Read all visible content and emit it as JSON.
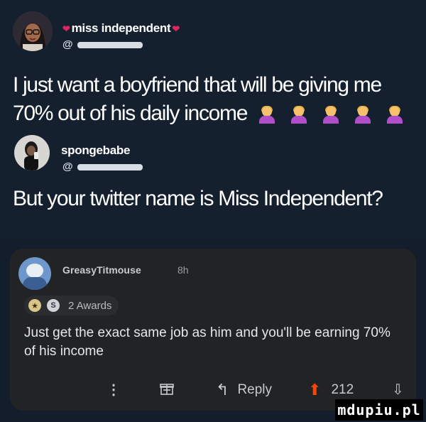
{
  "tweets": [
    {
      "display_name": "miss independent",
      "handle_prefix": "@",
      "text": "I just want a boyfriend that will be giving me 70% out of his daily income",
      "emojis": [
        "woman-tipping-hand-icon",
        "woman-tipping-hand-icon",
        "woman-tipping-hand-icon",
        "woman-tipping-hand-icon",
        "woman-tipping-hand-icon"
      ],
      "heart_color": "#e0245e"
    },
    {
      "display_name": "spongebabe",
      "handle_prefix": "@",
      "text": "But your twitter name is Miss Independent?"
    }
  ],
  "reddit": {
    "author": "GreasyTitmouse",
    "time": "8h",
    "awards_label": "2 Awards",
    "comment": "Just get the exact same job as him and you'll be earning 70% of his income",
    "actions": {
      "more": "⋮",
      "reply_label": "Reply",
      "score": "212"
    },
    "upvote_color": "#ff4500"
  },
  "watermark": "mdupiu.pl",
  "colors": {
    "twitter_bg": "#15202f",
    "reddit_card_bg": "#222325",
    "reddit_accent": "#ff4500"
  }
}
